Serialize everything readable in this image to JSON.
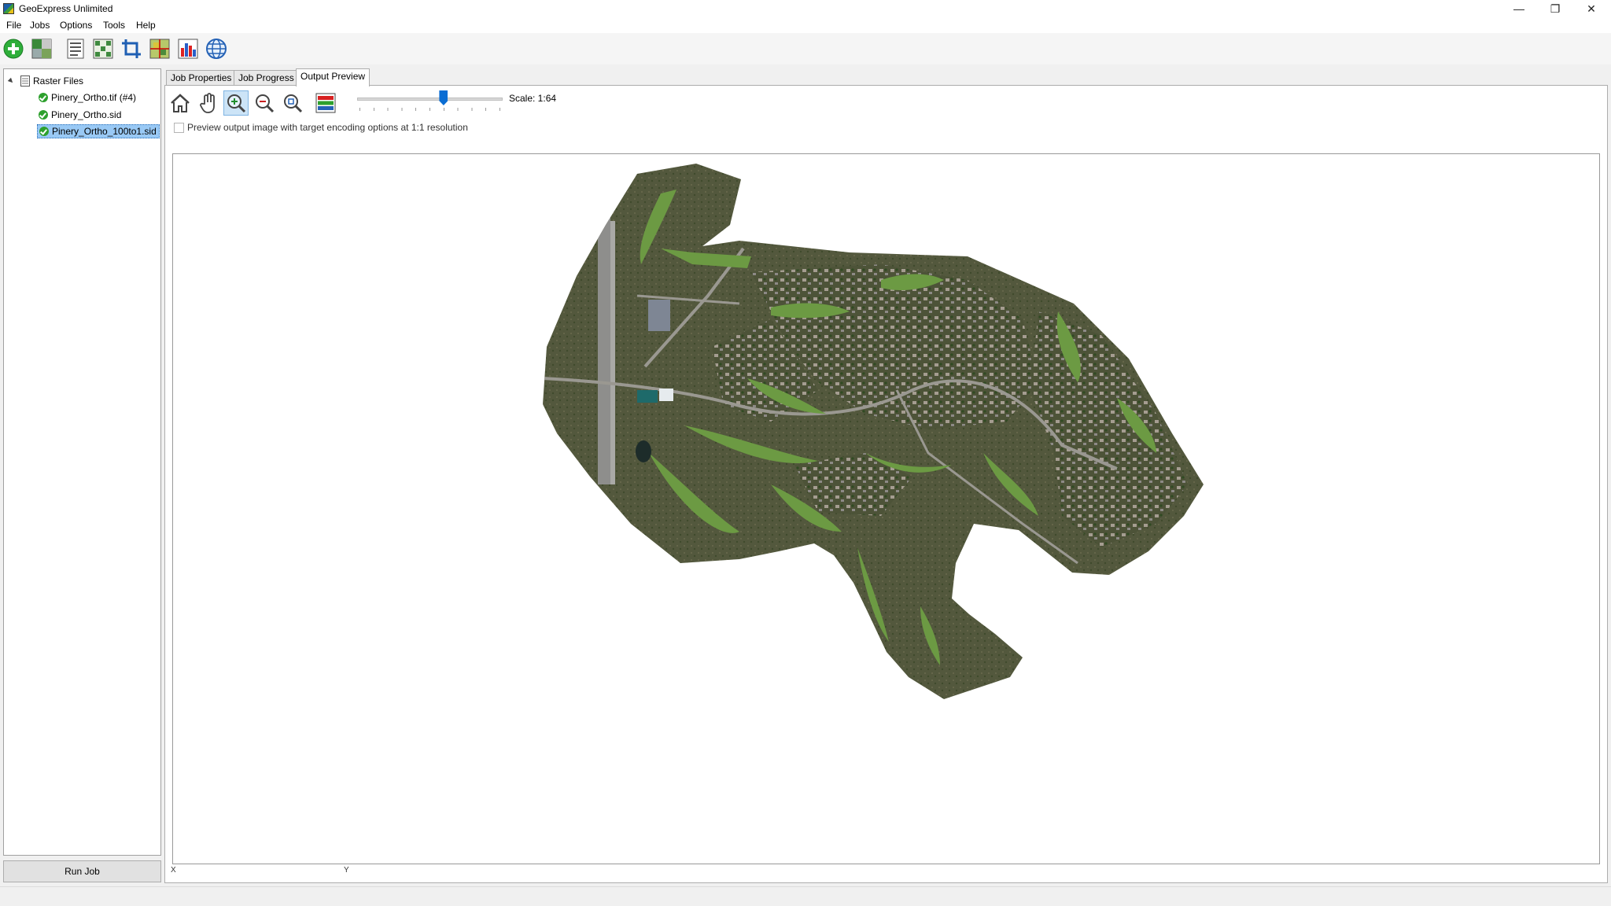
{
  "window": {
    "title": "GeoExpress Unlimited",
    "controls": {
      "minimize": "—",
      "restore": "❐",
      "close": "✕"
    }
  },
  "menu": [
    "File",
    "Jobs",
    "Options",
    "Tools",
    "Help"
  ],
  "toolbar": {
    "buttons": [
      "add-file-icon",
      "mosaic-icon",
      "properties-icon",
      "metadata-icon",
      "crop-icon",
      "grid-icon",
      "histogram-icon",
      "globe-icon"
    ]
  },
  "tree": {
    "root": "Raster Files",
    "children": [
      {
        "label": "Pinery_Ortho.tif (#4)",
        "status": "ok"
      },
      {
        "label": "Pinery_Ortho.sid",
        "status": "ok"
      },
      {
        "label": "Pinery_Ortho_100to1.sid",
        "status": "ok",
        "selected": true
      }
    ]
  },
  "run_job_label": "Run Job",
  "tabs": [
    "Job Properties",
    "Job Progress",
    "Output Preview"
  ],
  "active_tab": "Output Preview",
  "preview": {
    "scale_label": "Scale: 1:64",
    "slider_value": 0.6,
    "checkbox_label": "Preview output image with target encoding options at 1:1 resolution",
    "checkbox_checked": false,
    "coord_x_label": "X",
    "coord_y_label": "Y"
  },
  "colors": {
    "accent": "#0a6dd3",
    "selection": "#99c9f5",
    "status_ok": "#2da02d",
    "ortho_base": "#4a5236",
    "fairway": "#6c9a43"
  }
}
